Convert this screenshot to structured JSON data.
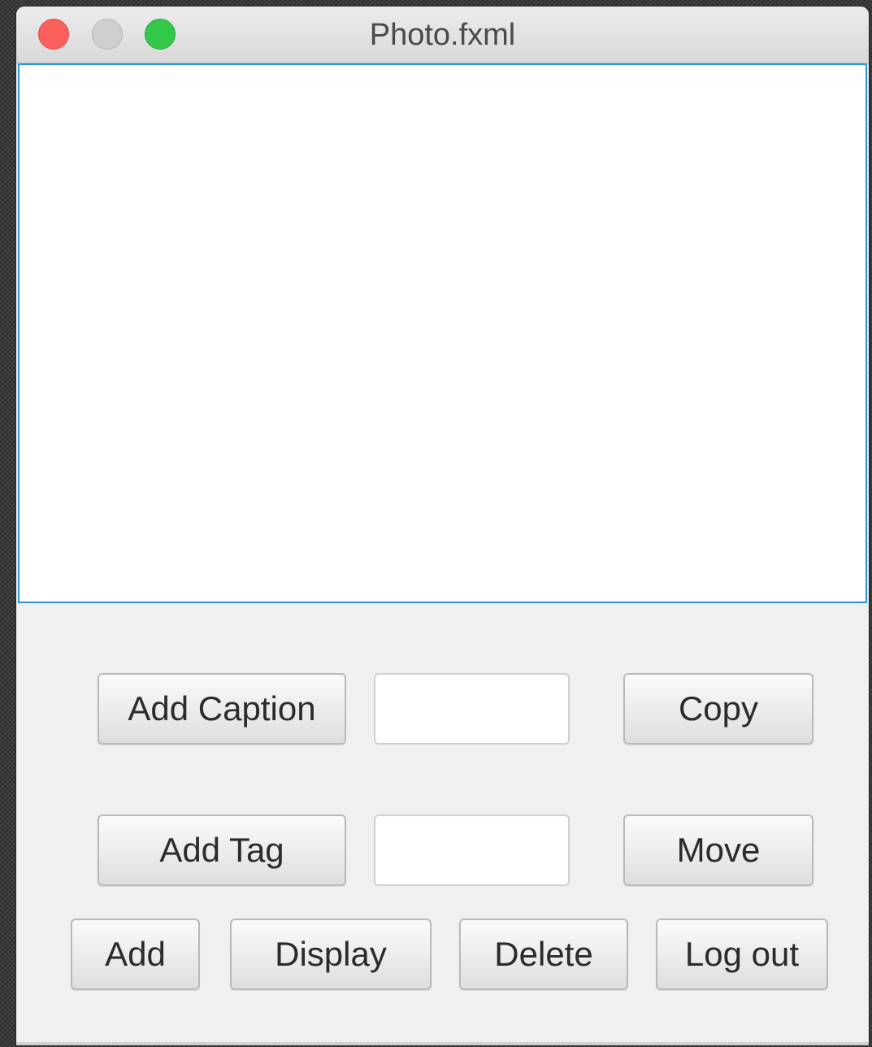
{
  "window": {
    "title": "Photo.fxml"
  },
  "row1": {
    "add_caption_label": "Add Caption",
    "caption_value": "",
    "copy_label": "Copy"
  },
  "row2": {
    "add_tag_label": "Add Tag",
    "tag_value": "",
    "move_label": "Move"
  },
  "row3": {
    "add_label": "Add",
    "display_label": "Display",
    "delete_label": "Delete",
    "logout_label": "Log out"
  },
  "colors": {
    "accent_focus": "#2a98d8",
    "close": "#fc605c",
    "minimize": "#cfcfcf",
    "zoom": "#34c84a"
  },
  "icons": {
    "close": "close-window-icon",
    "minimize": "minimize-window-icon",
    "zoom": "zoom-window-icon"
  }
}
